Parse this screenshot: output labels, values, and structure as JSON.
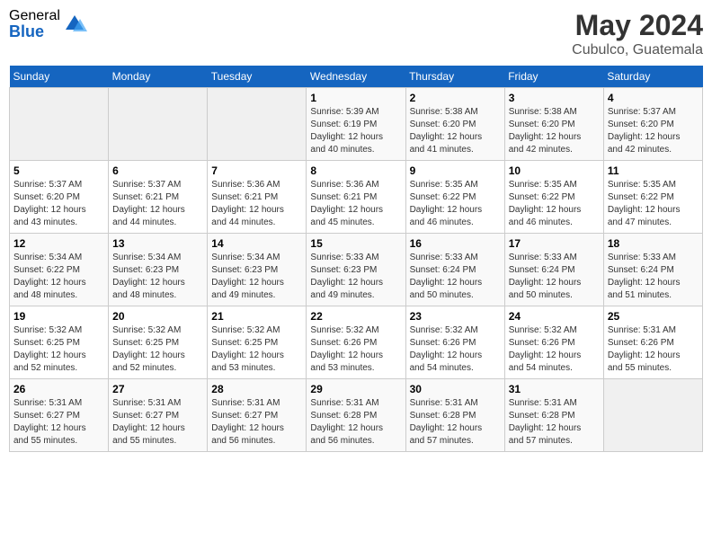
{
  "logo": {
    "general": "General",
    "blue": "Blue"
  },
  "title": {
    "month_year": "May 2024",
    "location": "Cubulco, Guatemala"
  },
  "calendar": {
    "headers": [
      "Sunday",
      "Monday",
      "Tuesday",
      "Wednesday",
      "Thursday",
      "Friday",
      "Saturday"
    ],
    "weeks": [
      [
        {
          "day": "",
          "info": ""
        },
        {
          "day": "",
          "info": ""
        },
        {
          "day": "",
          "info": ""
        },
        {
          "day": "1",
          "info": "Sunrise: 5:39 AM\nSunset: 6:19 PM\nDaylight: 12 hours\nand 40 minutes."
        },
        {
          "day": "2",
          "info": "Sunrise: 5:38 AM\nSunset: 6:20 PM\nDaylight: 12 hours\nand 41 minutes."
        },
        {
          "day": "3",
          "info": "Sunrise: 5:38 AM\nSunset: 6:20 PM\nDaylight: 12 hours\nand 42 minutes."
        },
        {
          "day": "4",
          "info": "Sunrise: 5:37 AM\nSunset: 6:20 PM\nDaylight: 12 hours\nand 42 minutes."
        }
      ],
      [
        {
          "day": "5",
          "info": "Sunrise: 5:37 AM\nSunset: 6:20 PM\nDaylight: 12 hours\nand 43 minutes."
        },
        {
          "day": "6",
          "info": "Sunrise: 5:37 AM\nSunset: 6:21 PM\nDaylight: 12 hours\nand 44 minutes."
        },
        {
          "day": "7",
          "info": "Sunrise: 5:36 AM\nSunset: 6:21 PM\nDaylight: 12 hours\nand 44 minutes."
        },
        {
          "day": "8",
          "info": "Sunrise: 5:36 AM\nSunset: 6:21 PM\nDaylight: 12 hours\nand 45 minutes."
        },
        {
          "day": "9",
          "info": "Sunrise: 5:35 AM\nSunset: 6:22 PM\nDaylight: 12 hours\nand 46 minutes."
        },
        {
          "day": "10",
          "info": "Sunrise: 5:35 AM\nSunset: 6:22 PM\nDaylight: 12 hours\nand 46 minutes."
        },
        {
          "day": "11",
          "info": "Sunrise: 5:35 AM\nSunset: 6:22 PM\nDaylight: 12 hours\nand 47 minutes."
        }
      ],
      [
        {
          "day": "12",
          "info": "Sunrise: 5:34 AM\nSunset: 6:22 PM\nDaylight: 12 hours\nand 48 minutes."
        },
        {
          "day": "13",
          "info": "Sunrise: 5:34 AM\nSunset: 6:23 PM\nDaylight: 12 hours\nand 48 minutes."
        },
        {
          "day": "14",
          "info": "Sunrise: 5:34 AM\nSunset: 6:23 PM\nDaylight: 12 hours\nand 49 minutes."
        },
        {
          "day": "15",
          "info": "Sunrise: 5:33 AM\nSunset: 6:23 PM\nDaylight: 12 hours\nand 49 minutes."
        },
        {
          "day": "16",
          "info": "Sunrise: 5:33 AM\nSunset: 6:24 PM\nDaylight: 12 hours\nand 50 minutes."
        },
        {
          "day": "17",
          "info": "Sunrise: 5:33 AM\nSunset: 6:24 PM\nDaylight: 12 hours\nand 50 minutes."
        },
        {
          "day": "18",
          "info": "Sunrise: 5:33 AM\nSunset: 6:24 PM\nDaylight: 12 hours\nand 51 minutes."
        }
      ],
      [
        {
          "day": "19",
          "info": "Sunrise: 5:32 AM\nSunset: 6:25 PM\nDaylight: 12 hours\nand 52 minutes."
        },
        {
          "day": "20",
          "info": "Sunrise: 5:32 AM\nSunset: 6:25 PM\nDaylight: 12 hours\nand 52 minutes."
        },
        {
          "day": "21",
          "info": "Sunrise: 5:32 AM\nSunset: 6:25 PM\nDaylight: 12 hours\nand 53 minutes."
        },
        {
          "day": "22",
          "info": "Sunrise: 5:32 AM\nSunset: 6:26 PM\nDaylight: 12 hours\nand 53 minutes."
        },
        {
          "day": "23",
          "info": "Sunrise: 5:32 AM\nSunset: 6:26 PM\nDaylight: 12 hours\nand 54 minutes."
        },
        {
          "day": "24",
          "info": "Sunrise: 5:32 AM\nSunset: 6:26 PM\nDaylight: 12 hours\nand 54 minutes."
        },
        {
          "day": "25",
          "info": "Sunrise: 5:31 AM\nSunset: 6:26 PM\nDaylight: 12 hours\nand 55 minutes."
        }
      ],
      [
        {
          "day": "26",
          "info": "Sunrise: 5:31 AM\nSunset: 6:27 PM\nDaylight: 12 hours\nand 55 minutes."
        },
        {
          "day": "27",
          "info": "Sunrise: 5:31 AM\nSunset: 6:27 PM\nDaylight: 12 hours\nand 55 minutes."
        },
        {
          "day": "28",
          "info": "Sunrise: 5:31 AM\nSunset: 6:27 PM\nDaylight: 12 hours\nand 56 minutes."
        },
        {
          "day": "29",
          "info": "Sunrise: 5:31 AM\nSunset: 6:28 PM\nDaylight: 12 hours\nand 56 minutes."
        },
        {
          "day": "30",
          "info": "Sunrise: 5:31 AM\nSunset: 6:28 PM\nDaylight: 12 hours\nand 57 minutes."
        },
        {
          "day": "31",
          "info": "Sunrise: 5:31 AM\nSunset: 6:28 PM\nDaylight: 12 hours\nand 57 minutes."
        },
        {
          "day": "",
          "info": ""
        }
      ]
    ]
  }
}
